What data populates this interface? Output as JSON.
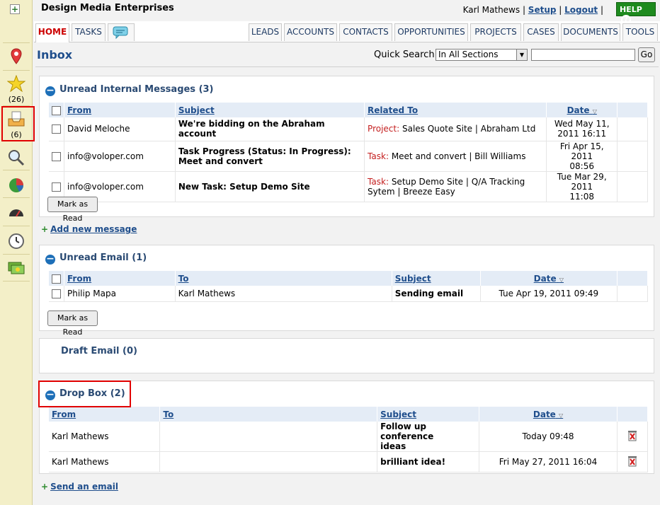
{
  "header": {
    "brand": "Design Media Enterprises",
    "user": "Karl Mathews",
    "setup": "Setup",
    "logout": "Logout",
    "help": "HELP"
  },
  "sidebar": {
    "favorites_count": "(26)",
    "inbox_count": "(6)"
  },
  "tabs_left": [
    "HOME",
    "TASKS"
  ],
  "tabs_right": [
    "LEADS",
    "ACCOUNTS",
    "CONTACTS",
    "OPPORTUNITIES",
    "PROJECTS",
    "CASES",
    "DOCUMENTS",
    "TOOLS"
  ],
  "main": {
    "title": "Inbox",
    "quick_search_label": "Quick Search",
    "quick_search_scope": "In All Sections",
    "go": "Go"
  },
  "unread_messages": {
    "title": "Unread Internal Messages (3)",
    "columns": [
      "From",
      "Subject",
      "Related To",
      "Date"
    ],
    "rows": [
      {
        "from": "David Meloche",
        "subject": "We're bidding on the Abraham account",
        "rel_type": "Project:",
        "rel_text": " Sales Quote Site | Abraham Ltd",
        "date1": "Wed May 11,",
        "date2": "2011 16:11"
      },
      {
        "from": "info@voloper.com",
        "subject1": "Task Progress (Status: In Progress):",
        "subject2": "Meet and convert",
        "rel_type": "Task:",
        "rel_text": " Meet and convert | Bill Williams",
        "date1": "Fri Apr 15, 2011",
        "date2": "08:56"
      },
      {
        "from": "info@voloper.com",
        "subject": "New Task: Setup Demo Site",
        "rel_type": "Task:",
        "rel_text1": " Setup Demo Site | Q/A Tracking",
        "rel_text2": "Sytem | Breeze Easy",
        "date1": "Tue Mar 29, 2011",
        "date2": "11:08"
      }
    ],
    "mark_read": "Mark as Read",
    "add_link": "Add new message"
  },
  "unread_email": {
    "title": "Unread Email (1)",
    "columns": [
      "From",
      "To",
      "Subject",
      "Date"
    ],
    "rows": [
      {
        "from": "Philip Mapa",
        "to": "Karl Mathews",
        "subject": "Sending email",
        "date": "Tue Apr 19, 2011 09:49"
      }
    ],
    "mark_read": "Mark as Read"
  },
  "draft_email": {
    "title": "Draft Email (0)"
  },
  "drop_box": {
    "title": "Drop Box (2)",
    "columns": [
      "From",
      "To",
      "Subject",
      "Date"
    ],
    "rows": [
      {
        "from": "Karl Mathews",
        "to": "",
        "subject1": "Follow up conference",
        "subject2": "ideas",
        "date": "Today 09:48"
      },
      {
        "from": "Karl Mathews",
        "to": "",
        "subject": "brilliant idea!",
        "date": "Fri May 27, 2011 16:04"
      }
    ],
    "send_link": "Send an email"
  }
}
